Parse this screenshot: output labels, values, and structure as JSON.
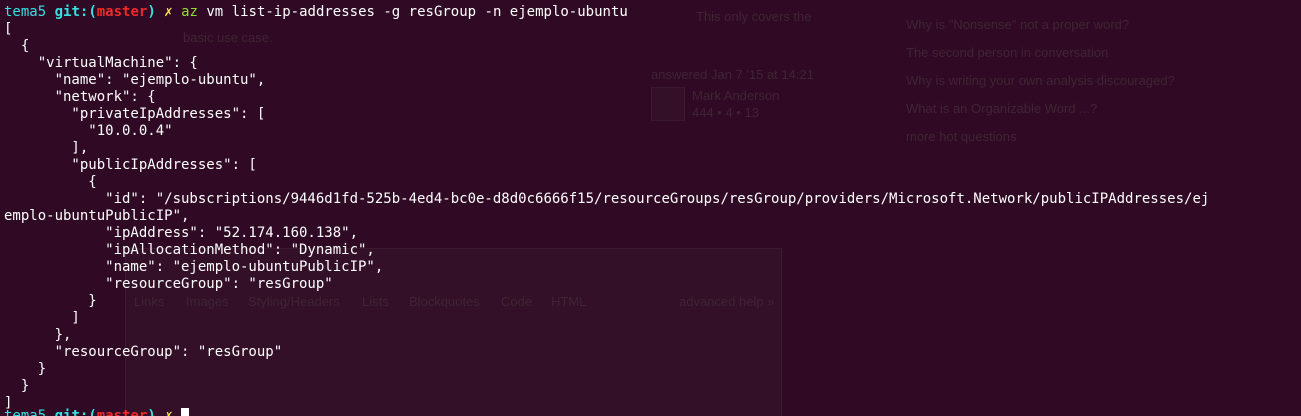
{
  "prompt": {
    "dir": "tema5",
    "git_label": "git:",
    "branch": "master",
    "dirty_mark": "✗",
    "command": "az",
    "args": "vm list-ip-addresses -g resGroup -n ejemplo-ubuntu"
  },
  "output_lines": [
    "[",
    "  {",
    "    \"virtualMachine\": {",
    "      \"name\": \"ejemplo-ubuntu\",",
    "      \"network\": {",
    "        \"privateIpAddresses\": [",
    "          \"10.0.0.4\"",
    "        ],",
    "        \"publicIpAddresses\": [",
    "          {",
    "            \"id\": \"/subscriptions/9446d1fd-525b-4ed4-bc0e-d8d0c6666f15/resourceGroups/resGroup/providers/Microsoft.Network/publicIPAddresses/ej",
    "emplo-ubuntuPublicIP\",",
    "            \"ipAddress\": \"52.174.160.138\",",
    "            \"ipAllocationMethod\": \"Dynamic\",",
    "            \"name\": \"ejemplo-ubuntuPublicIP\",",
    "            \"resourceGroup\": \"resGroup\"",
    "          }",
    "        ]",
    "      },",
    "      \"resourceGroup\": \"resGroup\"",
    "    }",
    "  }",
    "]"
  ],
  "background_ghost": {
    "right_links": [
      "Why is \"Nonsense\" not a proper word?",
      "The second person in conversation",
      "Why is writing your own analysis discouraged?",
      "What is an Organizable Word ...?",
      "more hot questions"
    ],
    "snippet_1": "This only covers the",
    "snippet_2": "basic use case.",
    "answered": "answered Jan 7 '15 at 14:21",
    "user": "Mark Anderson",
    "rep": "444 • 4 • 13",
    "toolbar": [
      "Links",
      "Images",
      "Styling/Headers",
      "Lists",
      "Blockquotes",
      "Code",
      "HTML"
    ],
    "help": "advanced help »"
  },
  "colors": {
    "background": "#300a24",
    "text": "#ffffff",
    "cyan": "#34e2e2",
    "red": "#ef2929",
    "yellow": "#fce94f",
    "green": "#8ae234"
  }
}
